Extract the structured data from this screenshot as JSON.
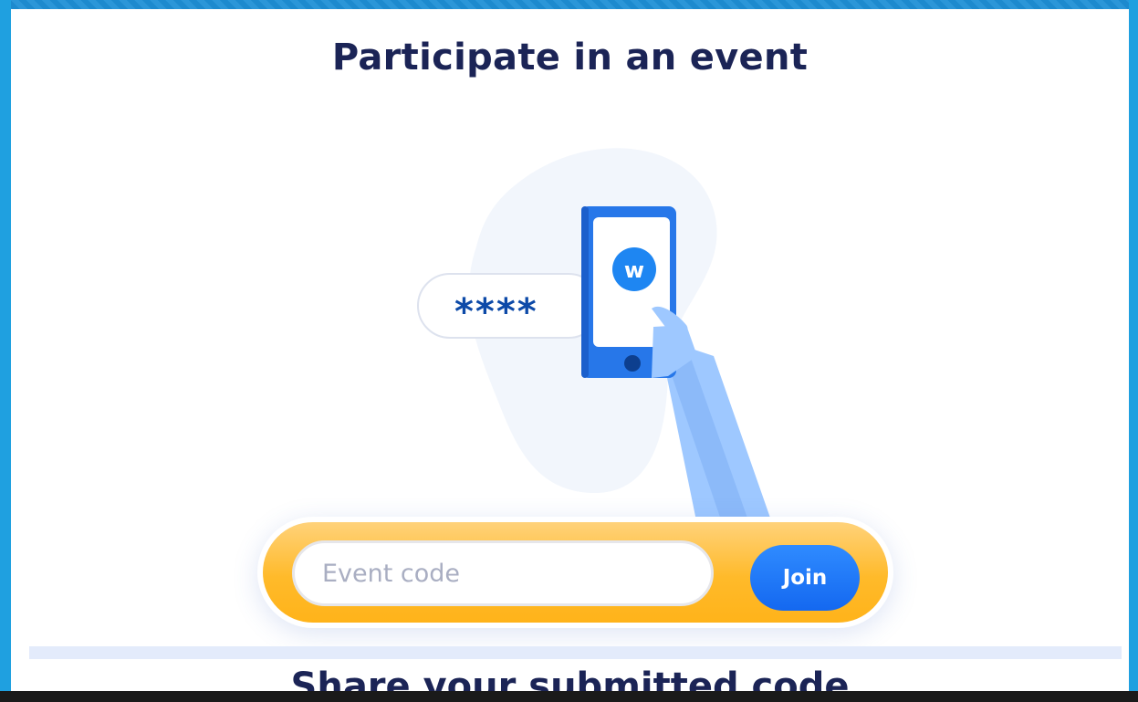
{
  "page": {
    "title": "Participate in an event"
  },
  "illustration": {
    "password_mask": "****",
    "app_logo_letter": "w"
  },
  "join_form": {
    "input_placeholder": "Event code",
    "input_value": "",
    "join_label": "Join"
  },
  "next_section": {
    "heading": "Share your submitted code"
  },
  "colors": {
    "title_text": "#1b2456",
    "join_button": "#1a72f5",
    "form_bar": "#ffbb2b",
    "background": "#1e90d6"
  },
  "icons": {
    "logo": "w-badge-icon",
    "phone": "phone-icon"
  }
}
